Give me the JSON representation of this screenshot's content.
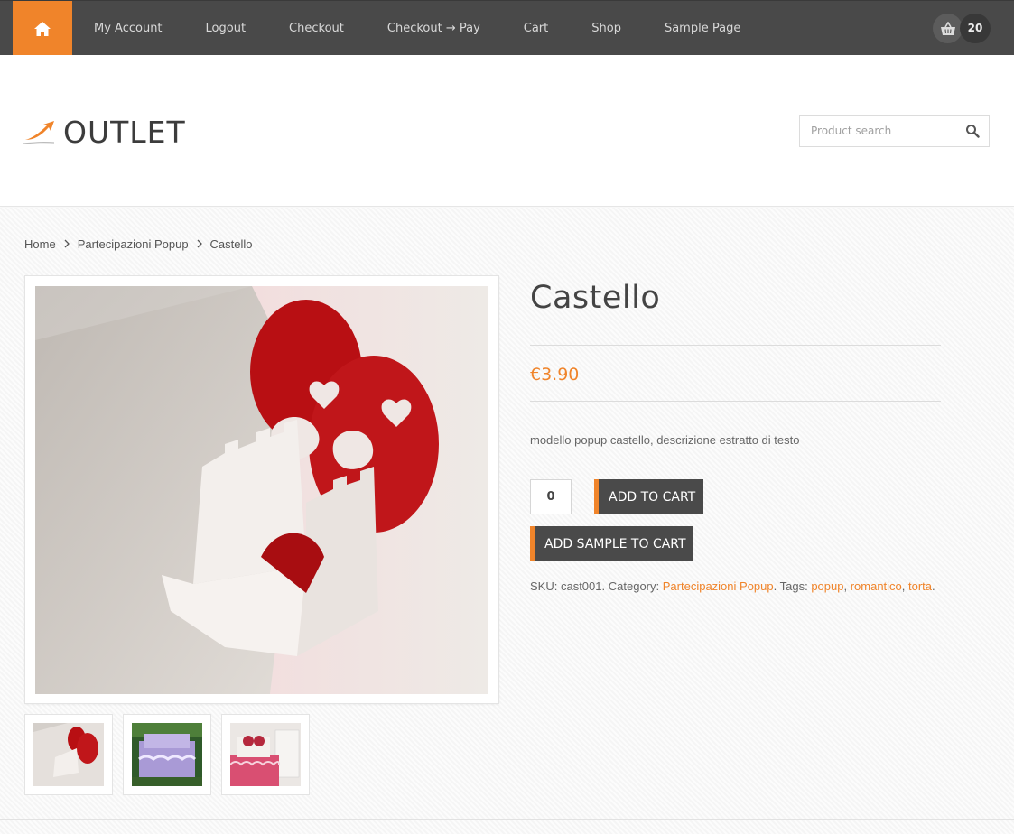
{
  "nav": {
    "items": [
      {
        "label": "My Account"
      },
      {
        "label": "Logout"
      },
      {
        "label": "Checkout"
      },
      {
        "label": "Checkout → Pay"
      },
      {
        "label": "Cart"
      },
      {
        "label": "Shop"
      },
      {
        "label": "Sample Page"
      }
    ],
    "cart_count": "20"
  },
  "header": {
    "logo_text": "OUTLET",
    "search_placeholder": "Product search"
  },
  "breadcrumb": {
    "items": [
      "Home",
      "Partecipazioni Popup",
      "Castello"
    ]
  },
  "product": {
    "title": "Castello",
    "price": "€3.90",
    "description": "modello popup castello, descrizione estratto di testo",
    "quantity": "0",
    "add_to_cart_label": "ADD TO CART",
    "add_sample_label": "ADD SAMPLE TO CART",
    "meta": {
      "sku_label": "SKU:",
      "sku": "cast001",
      "category_label": "Category:",
      "category": "Partecipazioni Popup",
      "tags_label": "Tags:",
      "tags": [
        "popup",
        "romantico",
        "torta"
      ]
    }
  },
  "colors": {
    "accent": "#f0842a",
    "nav_bg": "#494949",
    "button_bg": "#4a4a4a"
  }
}
